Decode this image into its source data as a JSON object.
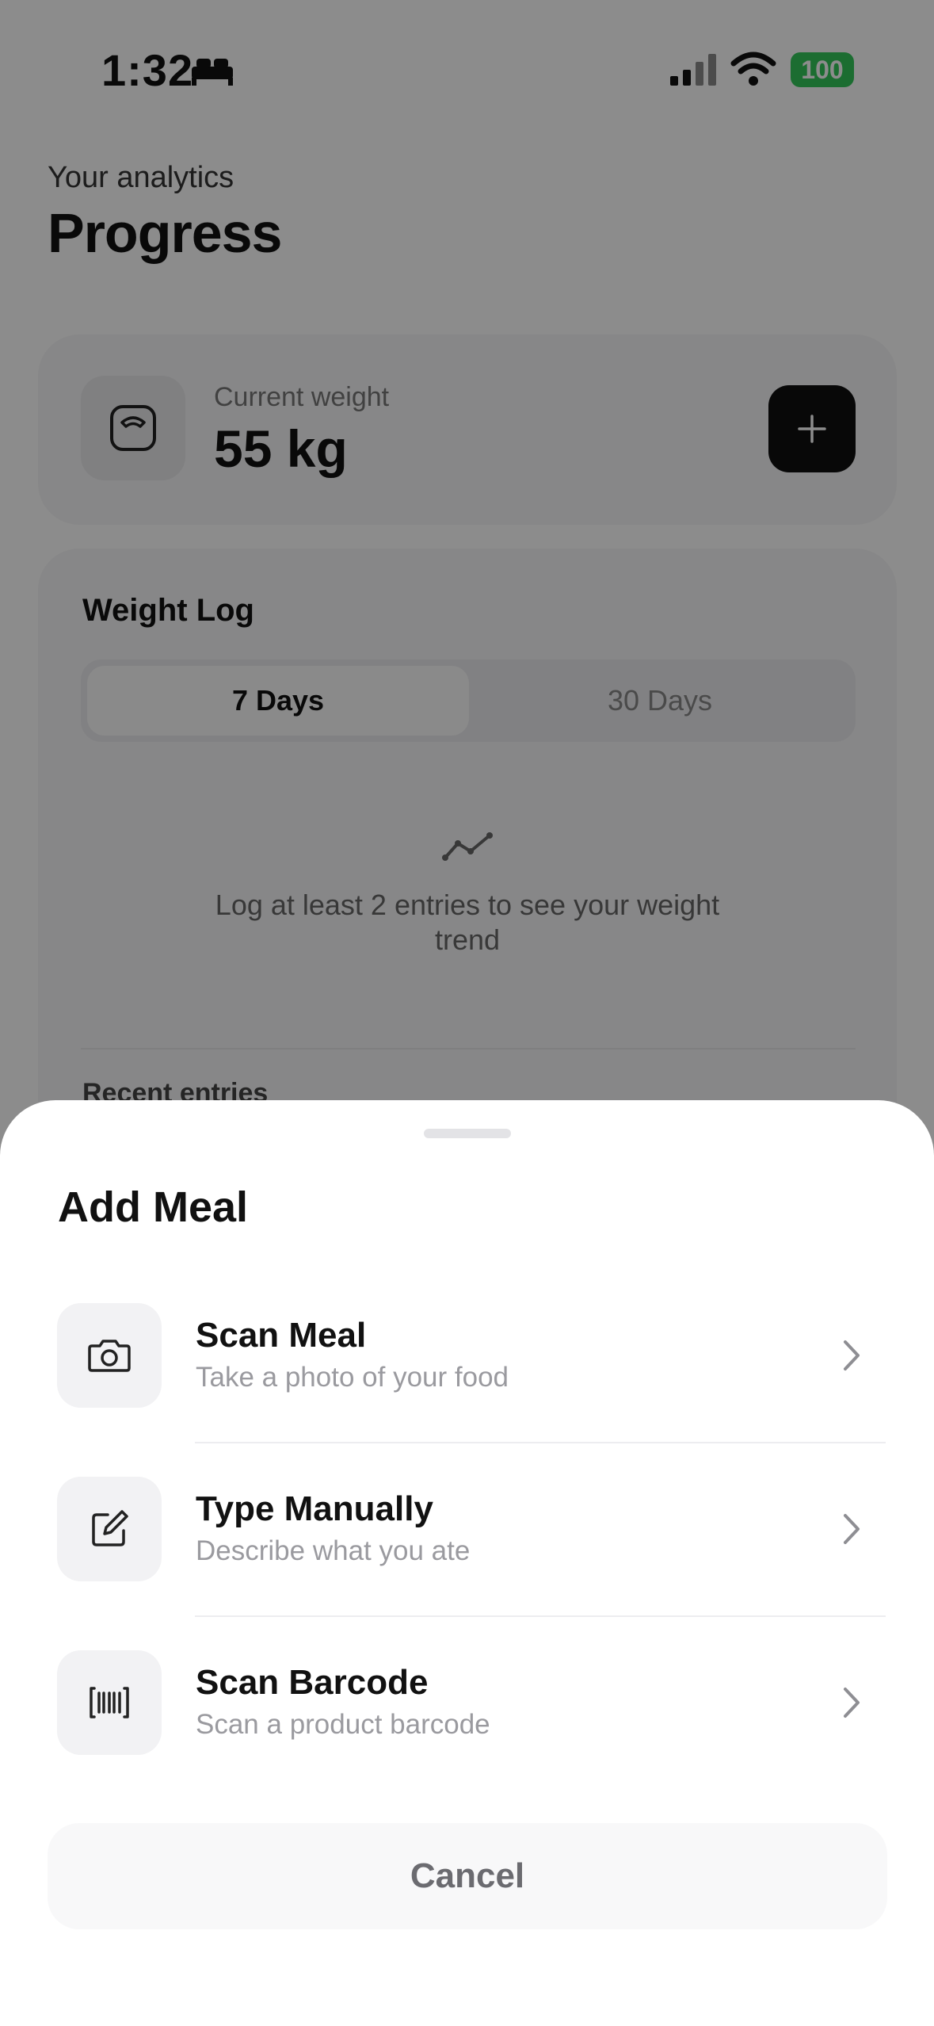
{
  "status_bar": {
    "time": "1:32",
    "battery": "100",
    "battery_color": "#34c759"
  },
  "header": {
    "subtitle": "Your analytics",
    "title": "Progress"
  },
  "weight_card": {
    "label": "Current weight",
    "value": "55 kg"
  },
  "weight_log": {
    "title": "Weight Log",
    "tabs": [
      {
        "label": "7 Days",
        "selected": true
      },
      {
        "label": "30 Days",
        "selected": false
      }
    ],
    "empty_message": "Log at least 2 entries to see your weight trend",
    "recent_label": "Recent entries"
  },
  "sheet": {
    "title": "Add Meal",
    "options": [
      {
        "title": "Scan Meal",
        "subtitle": "Take a photo of your food",
        "icon": "camera-icon"
      },
      {
        "title": "Type Manually",
        "subtitle": "Describe what you ate",
        "icon": "edit-icon"
      },
      {
        "title": "Scan Barcode",
        "subtitle": "Scan a product barcode",
        "icon": "barcode-icon"
      }
    ],
    "cancel_label": "Cancel"
  }
}
